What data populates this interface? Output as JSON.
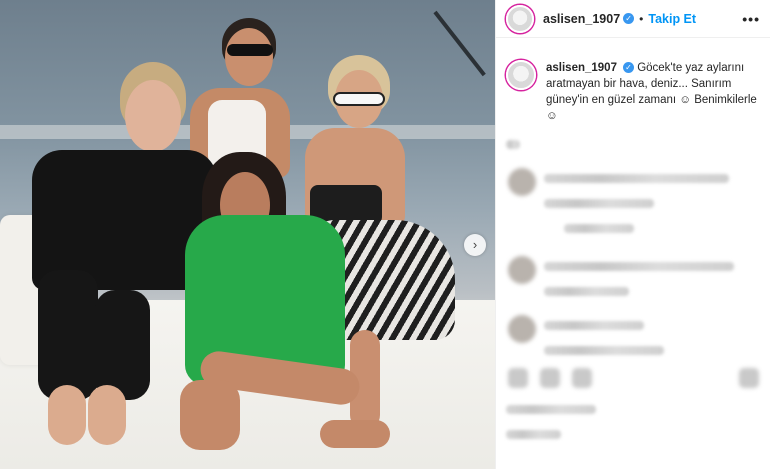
{
  "post": {
    "username": "aslisen_1907",
    "verified_icon": "verified-badge-icon",
    "separator": "•",
    "follow_label": "Takip Et",
    "more_icon": "more-options-icon",
    "more_glyph": "•••",
    "next_arrow_glyph": "›"
  },
  "caption": {
    "username": "aslisen_1907",
    "text": "Göcek'te yaz aylarını aratmayan bir hava, deniz... Sanırım güney'in en güzel zamanı ☺ Benimkilerle ☺"
  },
  "colors": {
    "accent": "#0095f6",
    "verified": "#3897f0",
    "story_ring": "#d6249f"
  }
}
